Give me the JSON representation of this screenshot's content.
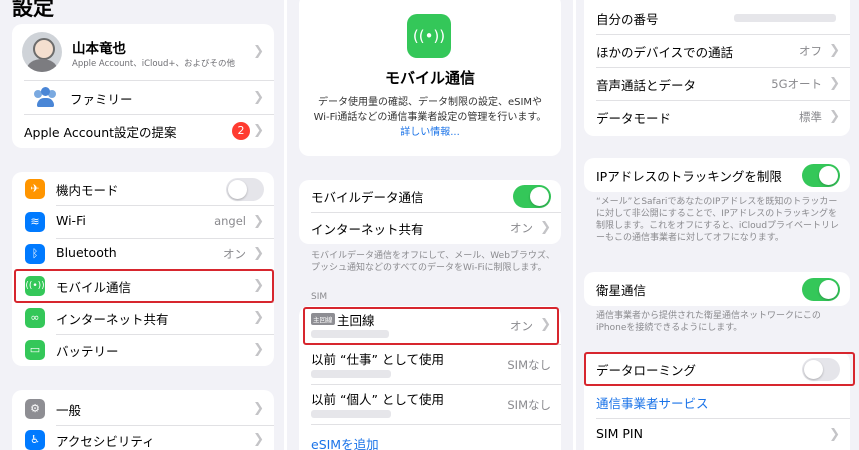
{
  "left": {
    "title": "設定",
    "profile": {
      "name": "山本竜也",
      "subtitle": "Apple Account、iCloud+、およびその他"
    },
    "family_label": "ファミリー",
    "suggestion": {
      "label": "Apple Account設定の提案",
      "badge": "2"
    },
    "connectivity": [
      {
        "label": "機内モード",
        "value": ""
      },
      {
        "label": "Wi-Fi",
        "value": "angel"
      },
      {
        "label": "Bluetooth",
        "value": "オン"
      },
      {
        "label": "モバイル通信",
        "value": ""
      },
      {
        "label": "インターネット共有",
        "value": ""
      },
      {
        "label": "バッテリー",
        "value": ""
      }
    ],
    "general": [
      {
        "label": "一般"
      },
      {
        "label": "アクセシビリティ"
      }
    ]
  },
  "middle": {
    "heading": "モバイル通信",
    "description": "データ使用量の確認、データ制限の設定、eSIMや Wi-Fi通話などの通信事業者設定の管理を行います。",
    "link": "詳しい情報...",
    "mobile_data_label": "モバイルデータ通信",
    "hotspot": {
      "label": "インターネット共有",
      "value": "オン"
    },
    "hotspot_footer": "モバイルデータ通信をオフにして、メール、Webブラウズ、プッシュ通知などのすべてのデータをWi-Fiに制限します。",
    "sim_header": "SIM",
    "primary_line": {
      "tag": "主回線",
      "label": "主回線",
      "value": "オン"
    },
    "former_work": {
      "label": "以前 “仕事” として使用",
      "value": "SIMなし"
    },
    "former_personal": {
      "label": "以前 “個人” として使用",
      "value": "SIMなし"
    },
    "add_esim": "eSIMを追加"
  },
  "right": {
    "rows1": [
      {
        "label": "自分の番号",
        "value": ""
      },
      {
        "label": "ほかのデバイスでの通話",
        "value": "オフ"
      },
      {
        "label": "音声通話とデータ",
        "value": "5Gオート"
      },
      {
        "label": "データモード",
        "value": "標準"
      }
    ],
    "ip_tracking_label": "IPアドレスのトラッキングを制限",
    "ip_footer": "“メール”とSafariであなたのIPアドレスを既知のトラッカーに対して非公開にすることで、IPアドレスのトラッキングを制限します。これをオフにすると、iCloudプライベートリレーもこの通信事業者に対してオフになります。",
    "satellite_label": "衛星通信",
    "satellite_footer": "通信事業者から提供された衛星通信ネットワークにこのiPhoneを接続できるようにします。",
    "roaming_label": "データローミング",
    "carrier_services": "通信事業者サービス",
    "sim_pin": "SIM PIN"
  },
  "colors": {
    "highlight": "#d7262e",
    "toggle_on": "#34c759",
    "link": "#1a73e8"
  }
}
